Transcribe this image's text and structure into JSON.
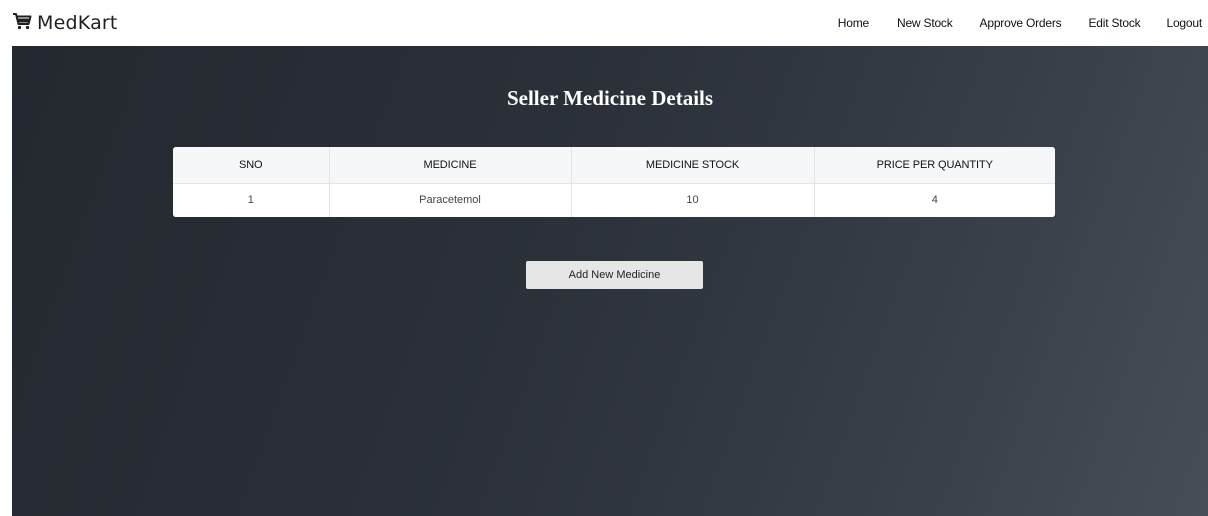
{
  "navbar": {
    "brand": "MedKart",
    "brand_icon": "cart-icon",
    "links": [
      "Home",
      "New Stock",
      "Approve Orders",
      "Edit Stock",
      "Logout"
    ]
  },
  "main": {
    "title": "Seller Medicine Details",
    "table": {
      "headers": [
        "SNO",
        "MEDICINE",
        "MEDICINE STOCK",
        "PRICE PER QUANTITY"
      ],
      "rows": [
        [
          "1",
          "Paracetemol",
          "10",
          "4"
        ]
      ]
    },
    "add_button_label": "Add New Medicine"
  },
  "colors": {
    "navbar_bg": "#ffffff",
    "main_bg_start": "#24282f",
    "main_bg_end": "#474e58",
    "button_bg": "#e6e6e6"
  }
}
